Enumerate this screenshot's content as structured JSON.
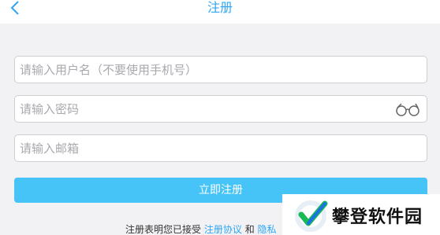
{
  "header": {
    "title": "注册",
    "back_icon": "chevron-left-icon"
  },
  "form": {
    "username_placeholder": "请输入用户名（不要使用手机号）",
    "password_placeholder": "请输入密码",
    "email_placeholder": "请输入邮箱",
    "password_toggle_icon": "glasses-icon",
    "submit_label": "立即注册"
  },
  "terms": {
    "prefix": "注册表明您已接受",
    "agreement_link": "注册协议",
    "and": "和",
    "privacy_link": "隐私"
  },
  "watermark": {
    "text": "攀登软件园",
    "icon": "checkmark-logo-icon"
  },
  "colors": {
    "accent": "#2fa5f3",
    "button": "#46c3f7",
    "background": "#f2f2f4"
  }
}
